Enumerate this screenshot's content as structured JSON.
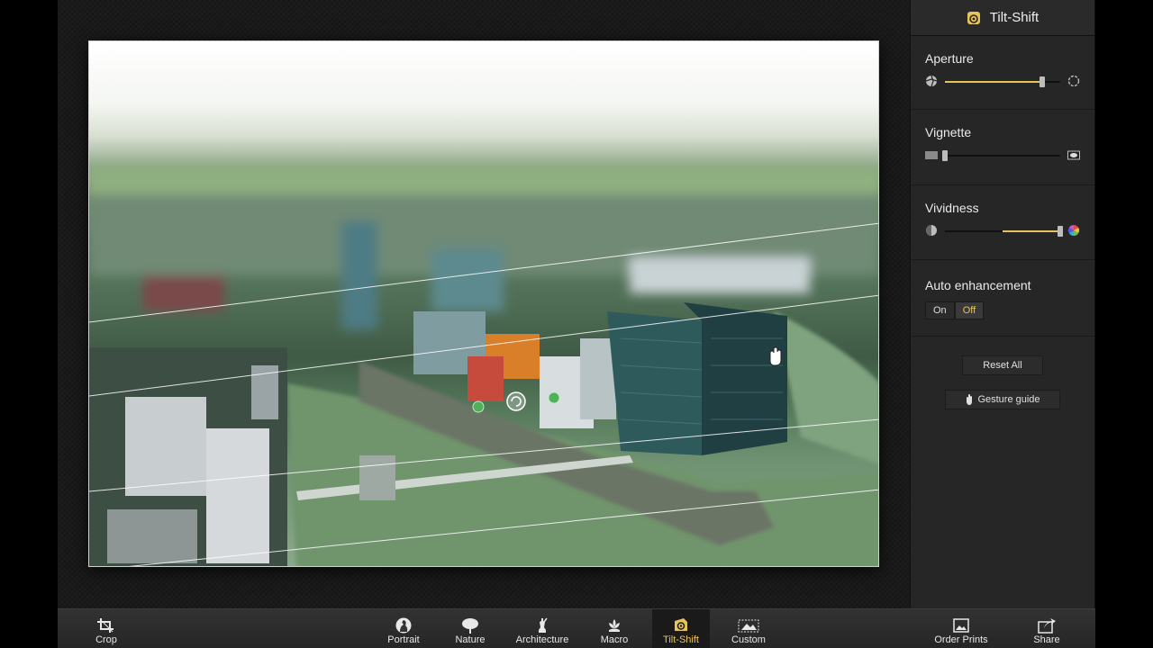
{
  "panel": {
    "title": "Tilt-Shift",
    "title_icon": "tilt-shift-icon",
    "aperture": {
      "label": "Aperture",
      "value": 0.84,
      "left_icon": "aperture-closed-icon",
      "right_icon": "aperture-open-icon"
    },
    "vignette": {
      "label": "Vignette",
      "value": 0.0,
      "left_icon": "vignette-off-icon",
      "right_icon": "vignette-on-icon"
    },
    "vividness": {
      "label": "Vividness",
      "value": 1.0,
      "mid": 0.5,
      "left_icon": "desaturate-icon",
      "right_icon": "color-wheel-icon"
    },
    "auto_enhancement": {
      "label": "Auto enhancement",
      "on_label": "On",
      "off_label": "Off",
      "selected": "Off"
    },
    "reset_label": "Reset All",
    "gesture_label": "Gesture guide"
  },
  "toolbar": {
    "crop": "Crop",
    "portrait": "Portrait",
    "nature": "Nature",
    "architecture": "Architecture",
    "macro": "Macro",
    "tilt_shift": "Tilt-Shift",
    "custom": "Custom",
    "order_prints": "Order Prints",
    "share": "Share",
    "active": "Tilt-Shift"
  },
  "colors": {
    "accent": "#e8c35a",
    "panel_bg": "#262626",
    "toolbar_bg": "#2c2c2c"
  }
}
